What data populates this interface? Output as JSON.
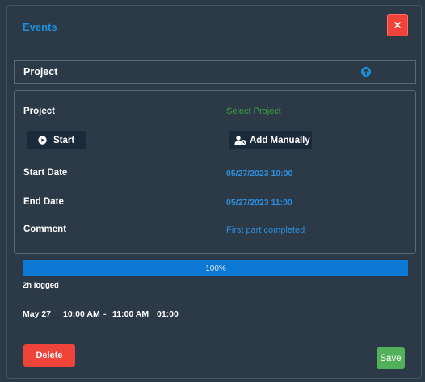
{
  "dialog": {
    "title": "Events",
    "close_icon": "close-icon"
  },
  "project_section": {
    "header": "Project",
    "collapse_icon": "arrow-up-circle-icon"
  },
  "form": {
    "project_label": "Project",
    "project_value": "Select Project",
    "start_button": {
      "label": "Start",
      "icon": "play-circle-icon"
    },
    "add_manually_button": {
      "label": "Add Manually",
      "icon": "user-clock-icon"
    },
    "start_date_label": "Start Date",
    "start_date_value": "05/27/2023 10:00",
    "end_date_label": "End Date",
    "end_date_value": "05/27/2023 11:00",
    "comment_label": "Comment",
    "comment_value": "First part completed"
  },
  "progress": {
    "value": 1.0,
    "label": "100%"
  },
  "logged": "2h logged",
  "time_summary": {
    "date": "May 27",
    "start": "10:00 AM",
    "separator": "-",
    "end": "11:00 AM",
    "duration": "01:00"
  },
  "actions": {
    "delete_label": "Delete",
    "save_label": "Save"
  },
  "colors": {
    "background": "#2c3a47",
    "accent_blue": "#1d8fe0",
    "danger": "#f0433a",
    "success": "#52b05a",
    "select_green": "#3f9f43"
  }
}
